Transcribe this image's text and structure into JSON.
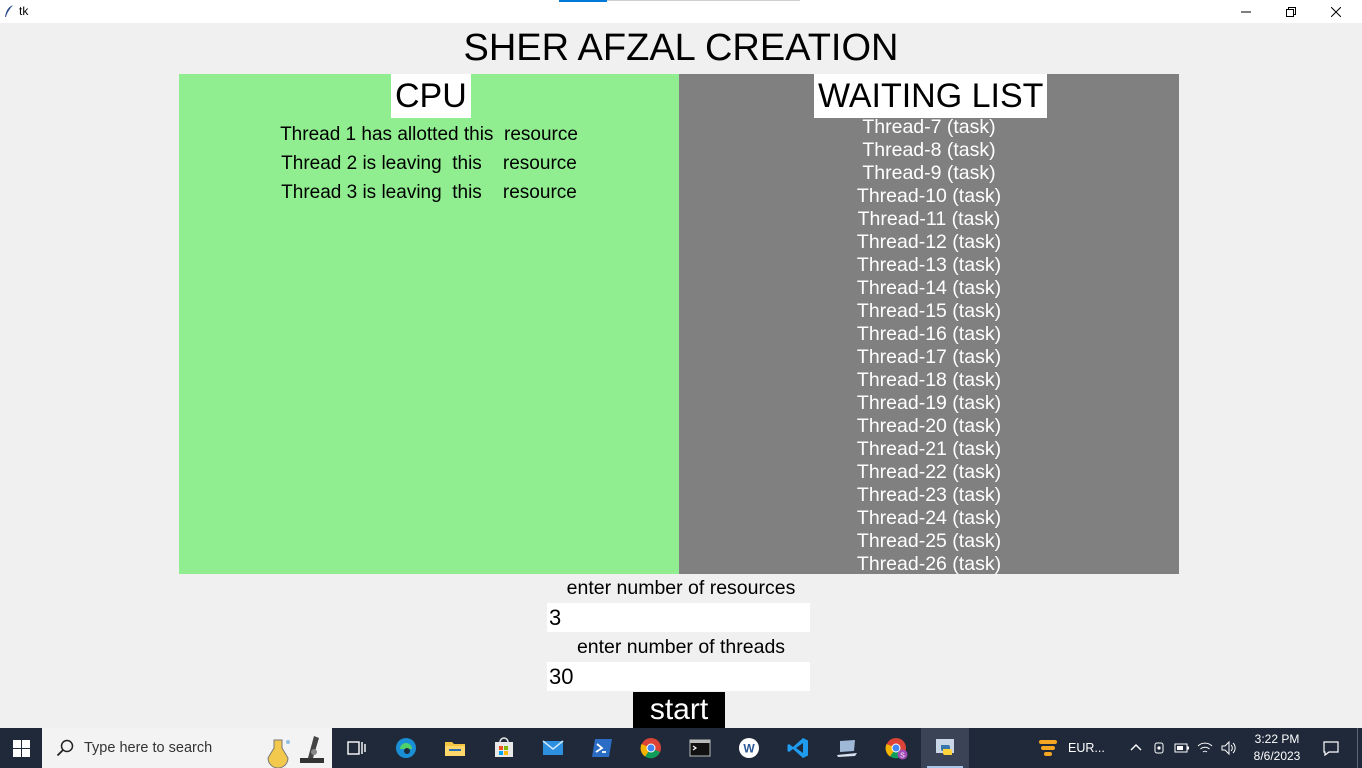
{
  "window": {
    "title": "tk"
  },
  "app": {
    "heading": "SHER AFZAL CREATION",
    "cpu": {
      "label": "CPU",
      "lines": [
        "Thread 1 has allotted this  resource",
        "Thread 2 is leaving  this    resource",
        "Thread 3 is leaving  this    resource"
      ]
    },
    "waiting": {
      "label": "WAITING LIST",
      "items": [
        "Thread-7 (task)",
        "Thread-8 (task)",
        "Thread-9 (task)",
        "Thread-10 (task)",
        "Thread-11 (task)",
        "Thread-12 (task)",
        "Thread-13 (task)",
        "Thread-14 (task)",
        "Thread-15 (task)",
        "Thread-16 (task)",
        "Thread-17 (task)",
        "Thread-18 (task)",
        "Thread-19 (task)",
        "Thread-20 (task)",
        "Thread-21 (task)",
        "Thread-22 (task)",
        "Thread-23 (task)",
        "Thread-24 (task)",
        "Thread-25 (task)",
        "Thread-26 (task)"
      ]
    },
    "form": {
      "resources_label": "enter number of resources",
      "resources_value": "3",
      "threads_label": "enter number of threads",
      "threads_value": "30",
      "start_label": "start"
    }
  },
  "taskbar": {
    "search_placeholder": "Type here to search",
    "weather_text": "EUR...",
    "time": "3:22 PM",
    "date": "8/6/2023",
    "icons": [
      "task-view-icon",
      "edge-icon",
      "file-explorer-icon",
      "store-icon",
      "mail-icon",
      "powershell-icon",
      "chrome-icon",
      "terminal-icon",
      "word-icon",
      "vscode-icon",
      "laptop-app-icon",
      "chrome-profile-icon",
      "python-icon"
    ]
  },
  "colors": {
    "cpu_panel": "#90ee90",
    "waiting_panel": "#808080",
    "taskbar": "#1f2939",
    "accent": "#0078d7"
  }
}
